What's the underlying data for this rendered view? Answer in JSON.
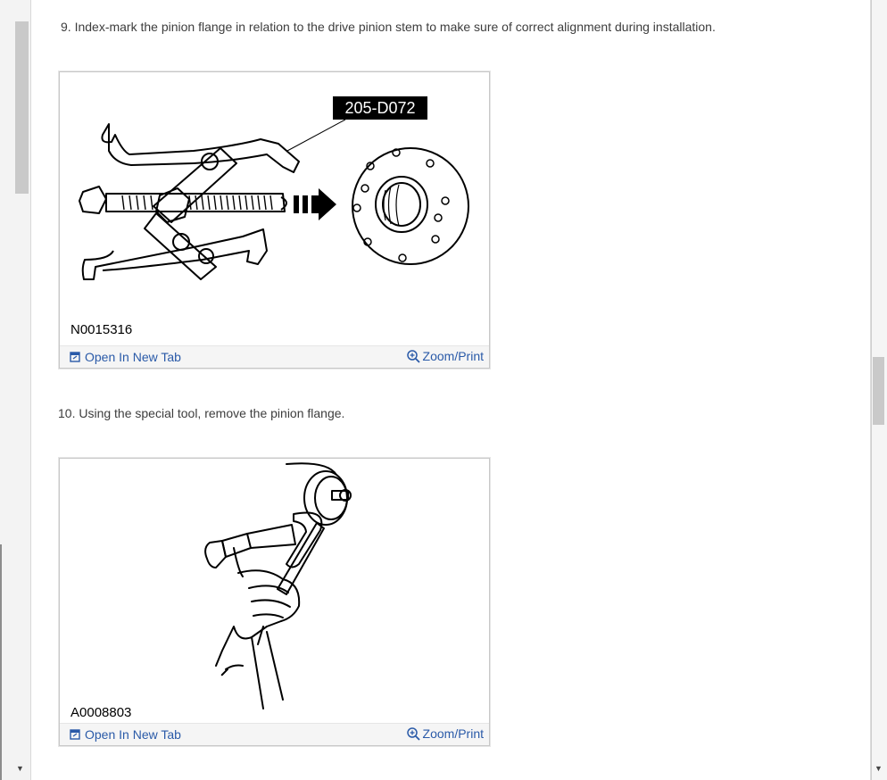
{
  "steps": [
    {
      "text": "9. Index-mark the pinion flange in relation to the drive pinion stem to make sure of correct alignment during installation.",
      "figure": {
        "callout": "205-D072",
        "code": "N0015316",
        "open_label": "Open In New Tab",
        "zoom_label": "Zoom/Print"
      }
    },
    {
      "text": "10. Using the special tool, remove the pinion flange.",
      "figure": {
        "code": "A0008803",
        "open_label": "Open In New Tab",
        "zoom_label": "Zoom/Print"
      }
    }
  ],
  "icons": {
    "open": "open-in-new-tab-icon",
    "zoom": "zoom-in-icon"
  },
  "colors": {
    "link": "#2a5aa8",
    "text": "#3d3d3d"
  }
}
